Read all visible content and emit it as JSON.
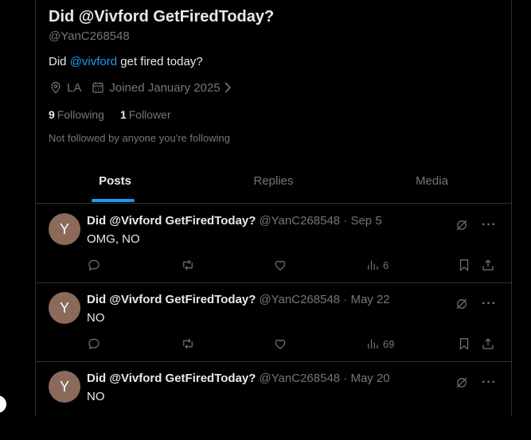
{
  "profile": {
    "name": "Did @Vivford GetFiredToday?",
    "handle": "@YanC268548",
    "bio_prefix": "Did ",
    "bio_mention": "@vivford",
    "bio_suffix": " get fired today?",
    "location": "LA",
    "joined": "Joined January 2025",
    "following_count": "9",
    "following_label": "Following",
    "followers_count": "1",
    "followers_label": "Follower",
    "not_followed": "Not followed by anyone you're following"
  },
  "tabs": [
    {
      "label": "Posts",
      "active": true
    },
    {
      "label": "Replies",
      "active": false
    },
    {
      "label": "Media",
      "active": false
    }
  ],
  "tweets": [
    {
      "avatar": "Y",
      "name": "Did @Vivford GetFiredToday?",
      "meta": "@YanC268548 · Sep 5",
      "text": "OMG, NO",
      "views": "6"
    },
    {
      "avatar": "Y",
      "name": "Did @Vivford GetFiredToday?",
      "meta": "@YanC268548 · May 22",
      "text": "NO",
      "views": "69"
    },
    {
      "avatar": "Y",
      "name": "Did @Vivford GetFiredToday?",
      "meta": "@YanC268548 · May 20",
      "text": "NO",
      "views": ""
    }
  ],
  "colors": {
    "accent": "#1d9bf0",
    "muted": "#71767b",
    "text": "#e7e9ea",
    "avatar": "#8c6a5b"
  }
}
